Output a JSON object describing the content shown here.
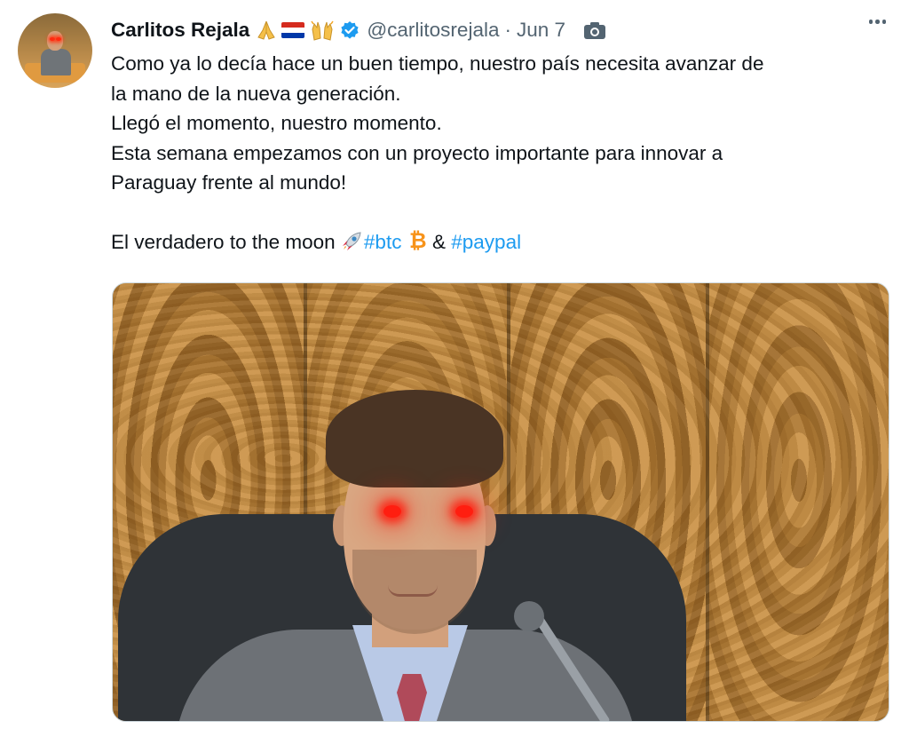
{
  "tweet": {
    "author_name": "Carlitos Rejala",
    "author_handle": "@carlitosrejala",
    "separator": "·",
    "date": "Jun 7",
    "name_emojis": [
      "folded-hands-icon",
      "paraguay-flag-icon",
      "raising-hands-icon"
    ],
    "verified_badge": "verified-badge-icon",
    "text_lines": [
      "Como ya lo decía hace un buen tiempo, nuestro país necesita avanzar de",
      "la mano de la nueva generación.",
      "Llegó el momento, nuestro momento.",
      "Esta semana empezamos con un proyecto importante para innovar a",
      "Paraguay frente al mundo!"
    ],
    "last_line": {
      "prefix": "El verdadero to the moon",
      "hashtag1": "#btc",
      "connector": "&",
      "hashtag2": "#paypal"
    }
  },
  "colors": {
    "text": "#0f1419",
    "secondary_text": "#536471",
    "link": "#1d9bf0",
    "verified": "#1d9bf0",
    "bitcoin": "#f7931a",
    "laser_eyes": "#ff1e10"
  }
}
